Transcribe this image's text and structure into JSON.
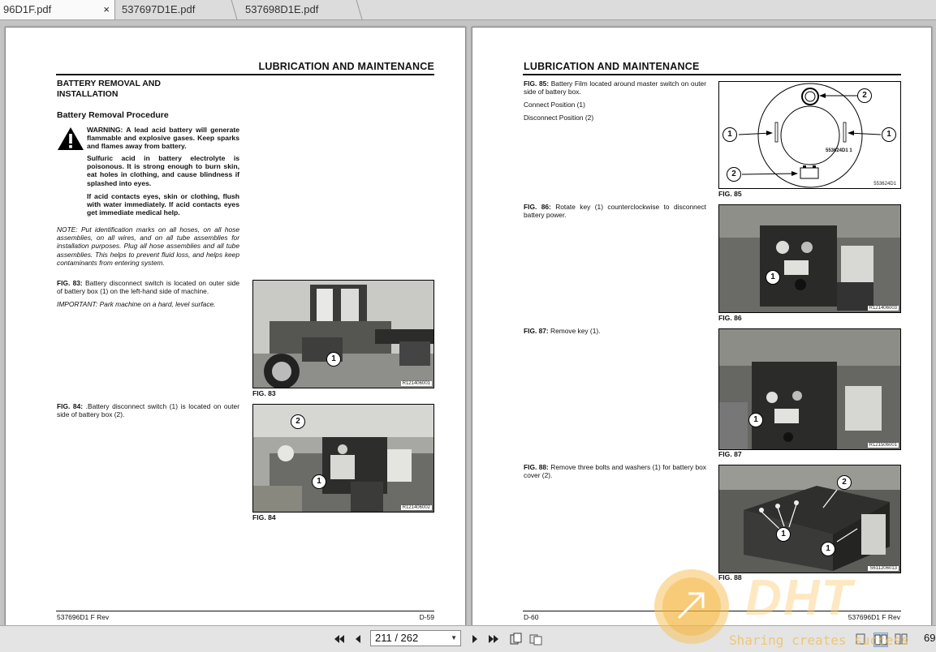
{
  "tabs": [
    {
      "label": "96D1F.pdf",
      "close": "×"
    },
    {
      "label": "537697D1E.pdf"
    },
    {
      "label": "537698D1E.pdf"
    }
  ],
  "left_page": {
    "header": "LUBRICATION AND MAINTENANCE",
    "section_title_1": "BATTERY REMOVAL AND",
    "section_title_2": "INSTALLATION",
    "subsection": "Battery Removal Procedure",
    "warning_1": "WARNING: A lead acid battery will generate flammable and explosive gases. Keep sparks and flames away from battery.",
    "warning_2": "Sulfuric acid in battery electrolyte is poisonous. It is strong enough to burn skin, eat holes in clothing, and cause blindness if splashed into eyes.",
    "warning_3": "If acid contacts eyes, skin or clothing, flush with water immediately. If acid contacts eyes get immediate medical help.",
    "note": "NOTE: Put identification marks on all hoses, on all hose assemblies, on all wires, and on all tube assemblies for installation purposes. Plug all hose assemblies and all tube assemblies. This helps to prevent fluid loss, and helps keep contaminants from entering system.",
    "fig83_ref": "FIG. 83:",
    "fig83_text": " Battery disconnect switch is located on outer side of battery box (1) on the left-hand side of machine.",
    "important": "IMPORTANT: Park machine on a hard, level surface.",
    "fig84_ref": "FIG. 84:",
    "fig84_text": " .Battery disconnect switch (1) is located on outer side of battery box (2).",
    "fig83_label": "FIG.  83",
    "fig83_code": "R121406001",
    "fig84_label": "FIG.  84",
    "fig84_code": "R121406002",
    "footer_left": "537696D1 F Rev",
    "footer_right": "D-59"
  },
  "right_page": {
    "header": "LUBRICATION AND MAINTENANCE",
    "fig85_ref": "FIG. 85:",
    "fig85_text": " Battery Film located around master switch on outer side of battery box.",
    "connect": "Connect Position (1)",
    "disconnect": "Disconnect Position (2)",
    "fig85_label": "FIG.  85",
    "fig85_code": "553624D1",
    "fig85_inner": "553624D1 1",
    "fig86_ref": "FIG. 86:",
    "fig86_text": " Rotate key (1) counterclockwise to disconnect battery power.",
    "fig86_label": "FIG.  86",
    "fig86_code": "R121406003",
    "fig87_ref": "FIG. 87:",
    "fig87_text": " Remove key (1).",
    "fig87_label": "FIG.  87",
    "fig87_code": "R121506001",
    "fig88_ref": "FIG. 88:",
    "fig88_text": " Remove three bolts and washers (1) for battery box cover (2).",
    "fig88_label": "FIG.  88",
    "fig88_code": "S611206013",
    "footer_left": "D-60",
    "footer_right": "537696D1 F Rev"
  },
  "callouts": {
    "one": "1",
    "two": "2"
  },
  "toolbar": {
    "page_value": "211 / 262",
    "zoom_partial": "69"
  },
  "watermark": {
    "brand": "DHT",
    "slogan": "Sharing creates success"
  },
  "icons": [
    "close-icon",
    "first-page-icon",
    "prev-page-icon",
    "next-page-icon",
    "last-page-icon",
    "fit-page-icon",
    "fit-width-icon",
    "single-page-icon",
    "two-page-icon",
    "warning-triangle-icon",
    "arrow-icon"
  ]
}
